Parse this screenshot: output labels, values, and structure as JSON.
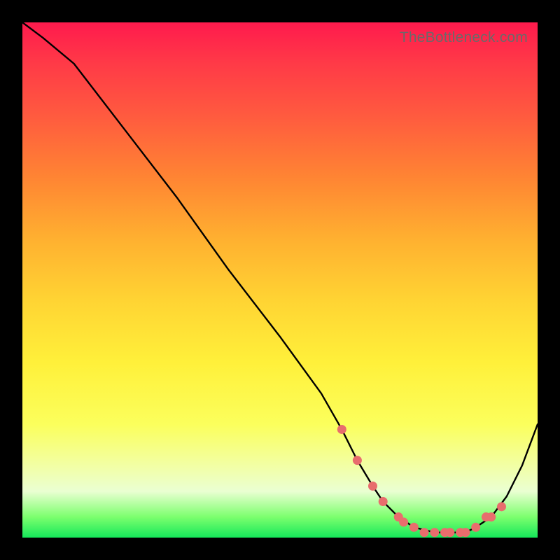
{
  "watermark": "TheBottleneck.com",
  "colors": {
    "background": "#000000",
    "line": "#000000",
    "marker": "#e86d6d"
  },
  "chart_data": {
    "type": "line",
    "title": "",
    "xlabel": "",
    "ylabel": "",
    "xlim": [
      0,
      100
    ],
    "ylim": [
      0,
      100
    ],
    "x": [
      0,
      4,
      10,
      20,
      30,
      40,
      50,
      58,
      62,
      65,
      68,
      70,
      73,
      76,
      80,
      83,
      86,
      88,
      91,
      94,
      97,
      100
    ],
    "values": [
      100,
      97,
      92,
      79,
      66,
      52,
      39,
      28,
      21,
      15,
      10,
      7,
      4,
      2,
      1,
      1,
      1,
      2,
      4,
      8,
      14,
      22
    ],
    "markers": {
      "x": [
        62,
        65,
        68,
        70,
        73,
        74,
        76,
        78,
        80,
        82,
        83,
        85,
        86,
        88,
        90,
        91,
        93
      ],
      "values": [
        21,
        15,
        10,
        7,
        4,
        3,
        2,
        1,
        1,
        1,
        1,
        1,
        1,
        2,
        4,
        4,
        6
      ]
    }
  }
}
